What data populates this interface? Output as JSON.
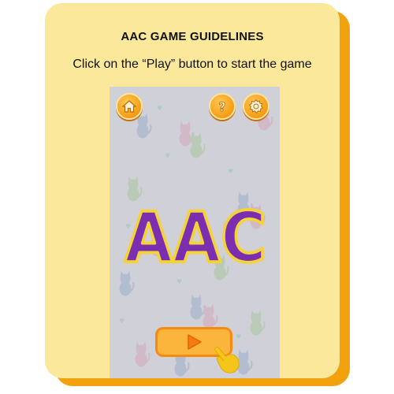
{
  "guide": {
    "title": "AAC GAME GUIDELINES",
    "instruction": "Click on the “Play” button to start the game"
  },
  "game": {
    "logo_text": "AAC",
    "colors": {
      "card": "#fbe89a",
      "card_shadow": "#f3a20f",
      "button_orange": "#f7a21c",
      "logo_purple": "#7b2fb0",
      "logo_outline": "#f4d23a",
      "screen_bg": "#cfd0d8"
    },
    "icons": {
      "home": "home-icon",
      "help": "question-icon",
      "settings": "gear-icon",
      "play": "play-icon",
      "pointer": "pointing-hand-icon"
    }
  }
}
